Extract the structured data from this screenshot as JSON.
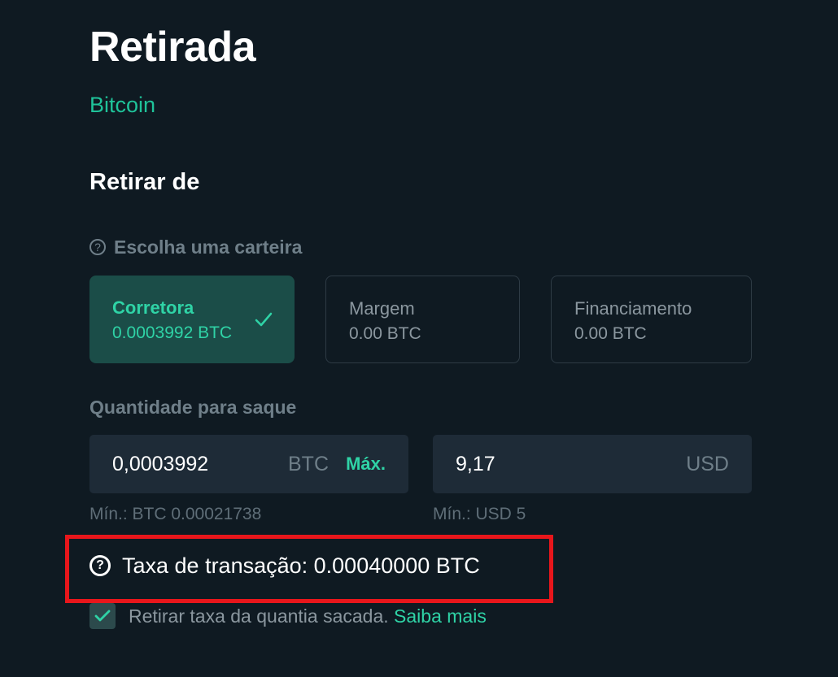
{
  "header": {
    "title": "Retirada",
    "currency": "Bitcoin"
  },
  "withdraw_from": {
    "heading": "Retirar de",
    "prompt": "Escolha uma carteira",
    "help_glyph": "?",
    "wallets": [
      {
        "name": "Corretora",
        "balance": "0.0003992 BTC",
        "selected": true
      },
      {
        "name": "Margem",
        "balance": "0.00 BTC",
        "selected": false
      },
      {
        "name": "Financiamento",
        "balance": "0.00 BTC",
        "selected": false
      }
    ]
  },
  "amount": {
    "label": "Quantidade para saque",
    "btc_value": "0,0003992",
    "btc_unit": "BTC",
    "max_label": "Máx.",
    "usd_value": "9,17",
    "usd_unit": "USD",
    "btc_min": "Mín.: BTC 0.00021738",
    "usd_min": "Mín.: USD 5"
  },
  "fee": {
    "help_glyph": "?",
    "text": "Taxa de transação: 0.00040000 BTC",
    "highlight_color": "#e8161b"
  },
  "deduct": {
    "checked": true,
    "text": "Retirar taxa da quantia sacada.",
    "learn_more": "Saiba mais"
  },
  "colors": {
    "background": "#0f1a22",
    "accent": "#2fd3a6",
    "selected_card": "#1b4d48",
    "input_bg": "#1e2b37"
  },
  "icons": {
    "check": "check-icon",
    "help": "question-circle-icon"
  }
}
